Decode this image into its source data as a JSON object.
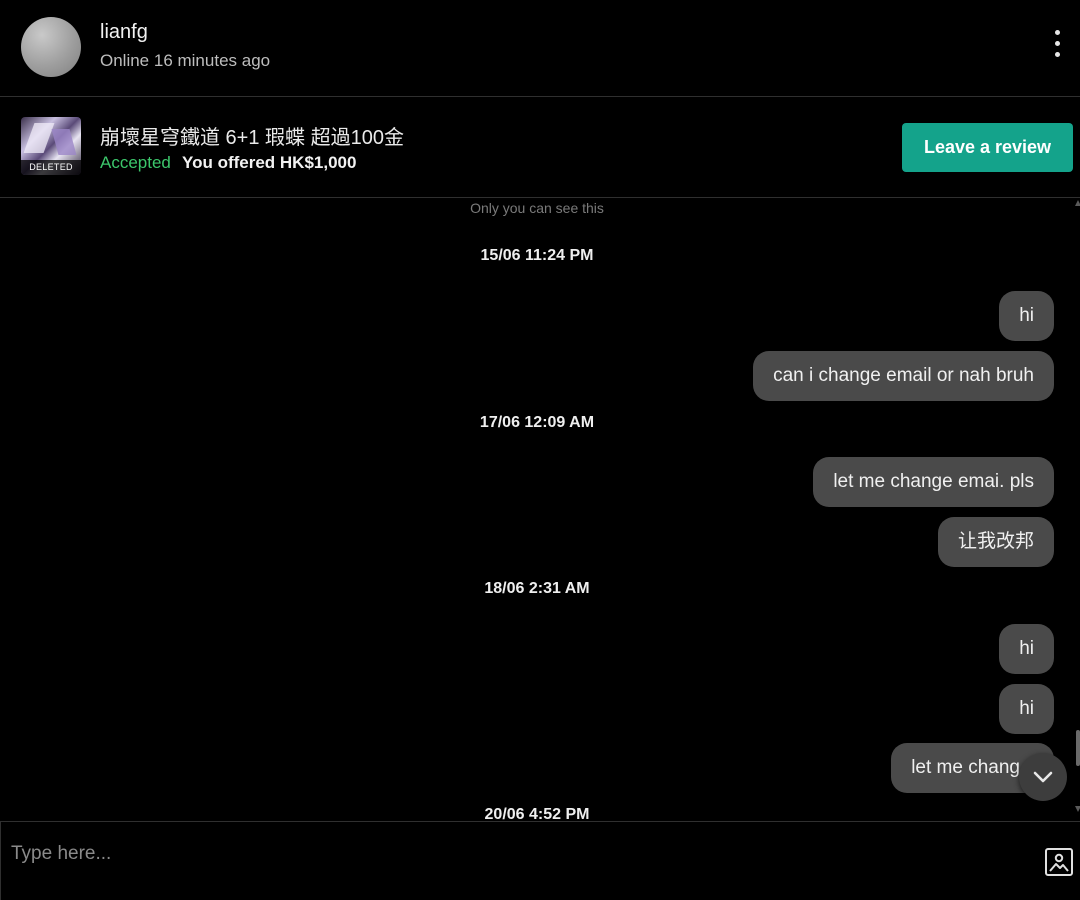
{
  "header": {
    "username": "lianfg",
    "status": "Online 16 minutes ago"
  },
  "listing": {
    "title": "崩壞星穹鐵道 6+1 瑕蝶 超過100金",
    "thumbnail_badge": "DELETED",
    "offer_status": "Accepted",
    "offer_text": "You offered HK$1,000",
    "review_button": "Leave a review"
  },
  "messages": {
    "notice": "Only you can see this",
    "dates": [
      "15/06  11:24 PM",
      "17/06  12:09 AM",
      "18/06  2:31 AM",
      "20/06  4:52 PM"
    ],
    "bubbles": [
      "hi",
      "can i change email or nah bruh",
      "let me change emai. pls",
      "让我改邦",
      "hi",
      "hi",
      "let me chang"
    ]
  },
  "composer": {
    "placeholder": "Type here..."
  },
  "icons": {
    "more": "more-vertical-icon",
    "scroll_down": "chevron-down-icon",
    "attach_image": "image-icon"
  },
  "colors": {
    "accent": "#14a38b",
    "accepted": "#3cc66b",
    "bubble": "#4a4a4a"
  }
}
